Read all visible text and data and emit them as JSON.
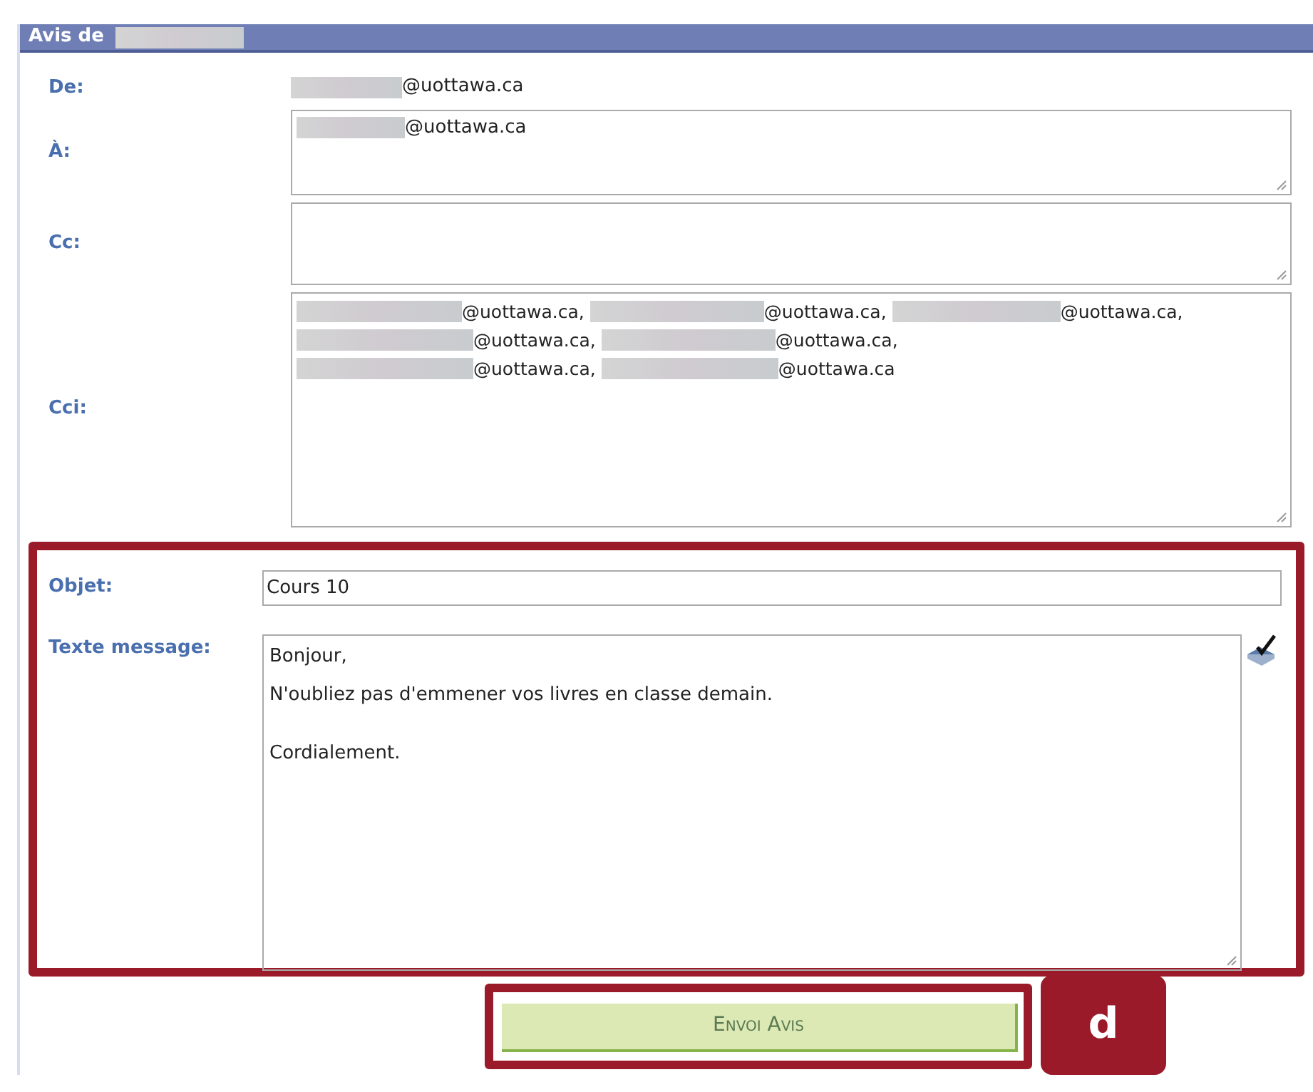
{
  "panel": {
    "title": "Avis de"
  },
  "from": {
    "label": "De:",
    "address": "@uottawa.ca"
  },
  "to": {
    "label": "À:",
    "addresses": [
      "@uottawa.ca"
    ]
  },
  "cc": {
    "label": "Cc:"
  },
  "bcc": {
    "label": "Cci:",
    "lines": [
      [
        "@uottawa.ca,",
        "@uottawa.ca,",
        "@uottawa.ca,"
      ],
      [
        "@uottawa.ca,",
        "@uottawa.ca,"
      ],
      [
        "@uottawa.ca,",
        "@uottawa.ca"
      ]
    ]
  },
  "subject": {
    "label": "Objet:",
    "value": "Cours 10"
  },
  "message": {
    "label": "Texte message:",
    "blocks": [
      [
        "Bonjour,",
        "N'oubliez pas d'emmener vos livres en classe demain."
      ],
      [
        "Cordialement."
      ]
    ]
  },
  "send_button": {
    "label": "Envoi Avis"
  },
  "callout": {
    "label": "d"
  }
}
